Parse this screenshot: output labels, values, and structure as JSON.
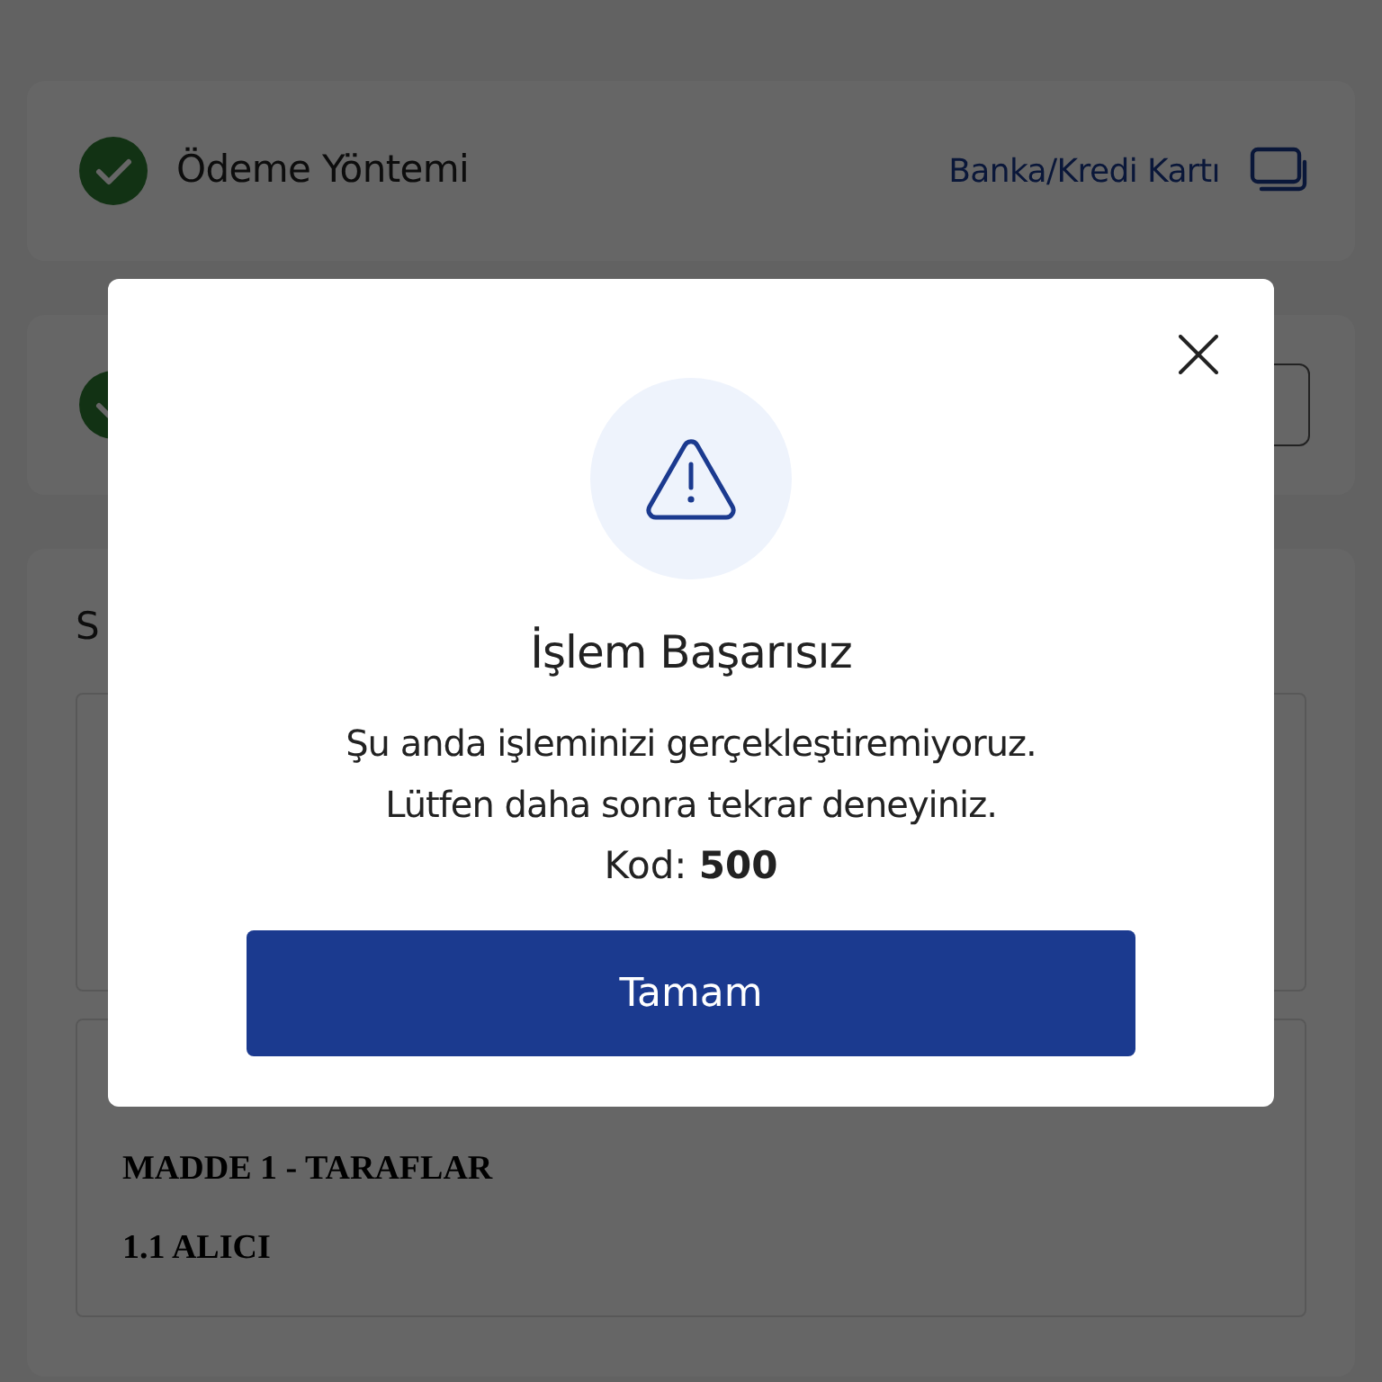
{
  "steps": [
    {
      "label": "Ödeme Yöntemi",
      "value": "Banka/Kredi Kartı",
      "completed": true
    },
    {
      "completed": true
    }
  ],
  "section": {
    "title": "S",
    "contract_headings": [
      "MADDE 1 - TARAFLAR",
      "1.1 ALICI"
    ]
  },
  "dialog": {
    "title": "İşlem Başarısız",
    "message": "Şu anda işleminizi gerçekleştiremiyoruz. Lütfen daha sonra tekrar deneyiniz.",
    "code": "Kod: **500**",
    "button": "Tamam"
  }
}
